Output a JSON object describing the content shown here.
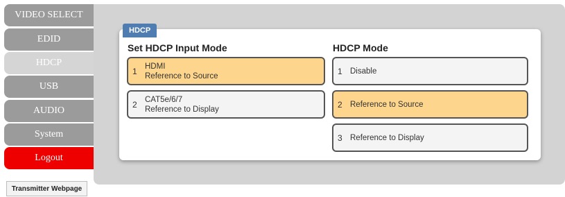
{
  "sidebar": {
    "items": [
      {
        "label": "VIDEO SELECT"
      },
      {
        "label": "EDID"
      },
      {
        "label": "HDCP"
      },
      {
        "label": "USB"
      },
      {
        "label": "AUDIO"
      },
      {
        "label": "System"
      },
      {
        "label": "Logout"
      }
    ],
    "transmitter_button": "Transmitter Webpage"
  },
  "card": {
    "tab_label": "HDCP",
    "input_mode": {
      "title": "Set HDCP Input Mode",
      "options": [
        {
          "num": "1",
          "line1": "HDMI",
          "line2": "Reference to Source",
          "selected": true
        },
        {
          "num": "2",
          "line1": "CAT5e/6/7",
          "line2": "Reference to Display",
          "selected": false
        }
      ]
    },
    "hdcp_mode": {
      "title": "HDCP Mode",
      "options": [
        {
          "num": "1",
          "label": "Disable",
          "selected": false
        },
        {
          "num": "2",
          "label": "Reference to Source",
          "selected": true
        },
        {
          "num": "3",
          "label": "Reference to Display",
          "selected": false
        }
      ]
    }
  },
  "colors": {
    "nav_gray": "#9b9b9b",
    "nav_active": "#d5d5d5",
    "logout_red": "#ee0000",
    "selected_orange": "#fdd58c",
    "tab_blue": "#4f7db1"
  }
}
